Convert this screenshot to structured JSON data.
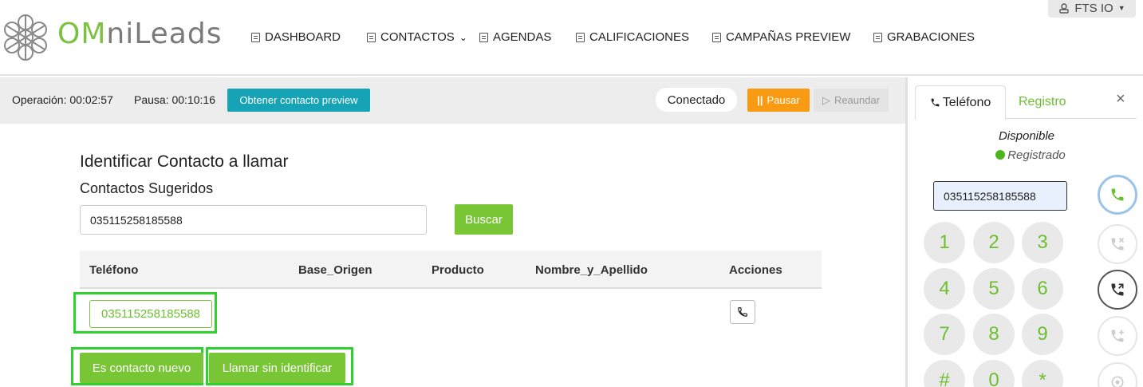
{
  "header": {
    "brand_prefix": "OM",
    "brand_suffix": "niLeads",
    "nav": [
      {
        "label": "DASHBOARD",
        "icon": "list-icon"
      },
      {
        "label": "CONTACTOS",
        "icon": "book-icon"
      },
      {
        "label": "AGENDAS",
        "icon": "list-icon"
      },
      {
        "label": "CALIFICACIONES",
        "icon": "check-square-icon"
      },
      {
        "label": "CAMPAÑAS PREVIEW",
        "icon": "list-icon"
      },
      {
        "label": "GRABACIONES",
        "icon": "chart-icon"
      }
    ],
    "user_label": "FTS IO"
  },
  "statusbar": {
    "operacion_label": "Operación:",
    "operacion_time": "00:02:57",
    "pausa_label": "Pausa:",
    "pausa_time": "00:10:16",
    "preview_button": "Obtener contacto preview",
    "connection_status": "Conectado",
    "pause_button": "Pausar",
    "resume_button": "Reaundar"
  },
  "main": {
    "title": "Identificar Contacto a llamar",
    "subtitle": "Contactos Sugeridos",
    "search_value": "035115258185588",
    "search_button": "Buscar",
    "table": {
      "columns": [
        "Teléfono",
        "Base_Origen",
        "Producto",
        "Nombre_y_Apellido",
        "Acciones"
      ],
      "rows": [
        {
          "telefono": "035115258185588",
          "base_origen": "",
          "producto": "",
          "nombre": ""
        }
      ]
    },
    "new_contact_button": "Es contacto nuevo",
    "call_unidentified_button": "Llamar sin identificar"
  },
  "phone": {
    "tab_phone": "Teléfono",
    "tab_registro": "Registro",
    "close": "×",
    "status": "Disponible",
    "registration": "Registrado",
    "dial_value": "035115258185588",
    "keys": [
      "1",
      "2",
      "3",
      "4",
      "5",
      "6",
      "7",
      "8",
      "9",
      "#",
      "0",
      "*"
    ]
  },
  "colors": {
    "brand_green": "#7cc142",
    "teal": "#16a3b5",
    "orange": "#f89b12",
    "highlight": "#2ed12e"
  }
}
